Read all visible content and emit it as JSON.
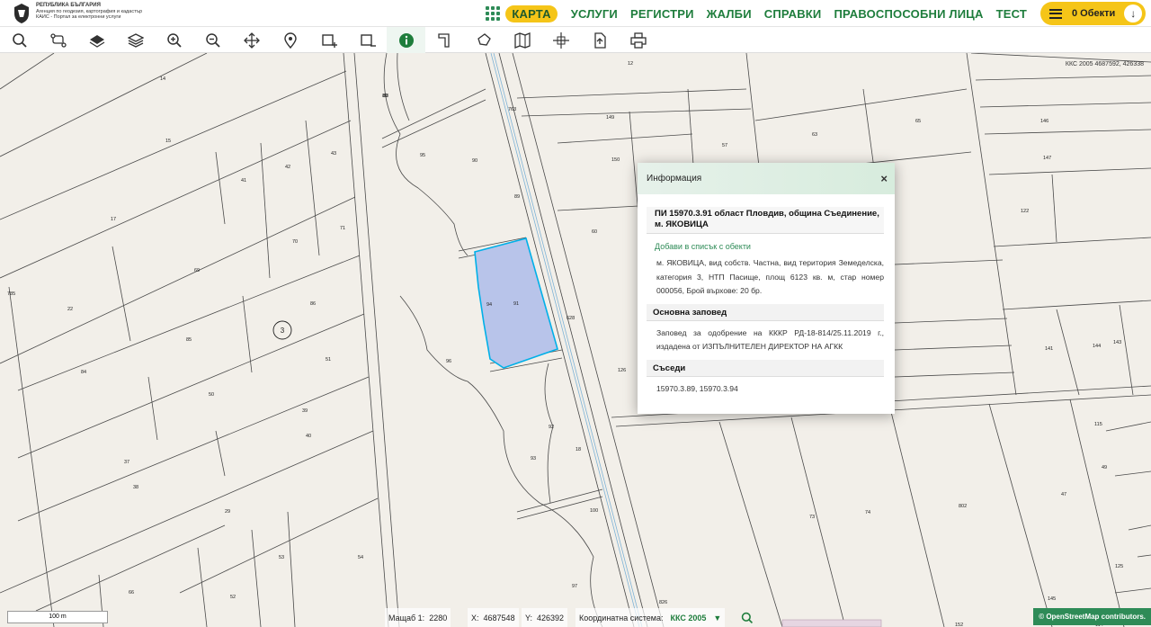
{
  "header": {
    "logo_line1": "РЕПУБЛИКА БЪЛГАРИЯ",
    "logo_line2": "Агенция по геодезия, картография и кадастър",
    "logo_line3": "КАИС - Портал за електронни услуги",
    "nav": [
      "КАРТА",
      "УСЛУГИ",
      "РЕГИСТРИ",
      "ЖАЛБИ",
      "СПРАВКИ",
      "ПРАВОСПОСОБНИ ЛИЦА",
      "ТЕСТ"
    ],
    "objects_label": "0 Обекти"
  },
  "toolbar": {
    "tools": [
      "search-icon",
      "route-icon",
      "layers-icon",
      "layers-alt-icon",
      "zoom-in-icon",
      "zoom-out-icon",
      "pan-icon",
      "location-pin-icon",
      "select-add-icon",
      "select-remove-icon",
      "info-icon",
      "measure-icon",
      "draw-polygon-icon",
      "map-icon",
      "crosshair-icon",
      "export-icon",
      "print-icon"
    ],
    "active": "info-icon"
  },
  "map": {
    "coord_label": "ККС 2005 4687592, 426338",
    "selected_parcel": "91",
    "marker_label": "3",
    "parcel_numbers": [
      "12",
      "14",
      "15",
      "17",
      "18",
      "22",
      "29",
      "37",
      "38",
      "39",
      "40",
      "41",
      "42",
      "43",
      "47",
      "49",
      "50",
      "51",
      "52",
      "53",
      "54",
      "57",
      "60",
      "63",
      "65",
      "66",
      "69",
      "70",
      "71",
      "73",
      "74",
      "80",
      "84",
      "85",
      "86",
      "88",
      "89",
      "90",
      "91",
      "92",
      "93",
      "94",
      "95",
      "96",
      "97",
      "100",
      "114",
      "115",
      "122",
      "125",
      "126",
      "141",
      "143",
      "144",
      "145",
      "146",
      "147",
      "149",
      "150",
      "152",
      "763",
      "785",
      "802",
      "826",
      "628"
    ],
    "scale_text": "100 m"
  },
  "popup": {
    "header": "Информация",
    "close": "×",
    "title": "ПИ 15970.3.91 област Пловдив, община Съединение, м. ЯКОВИЦА",
    "add_link": "Добави в списък с обекти",
    "description": "м. ЯКОВИЦА, вид собств. Частна, вид територия Земеделска, категория 3, НТП Пасище, площ 6123 кв. м, стар номер 000056, Брой върхове: 20 бр.",
    "order_heading": "Основна заповед",
    "order_text": "Заповед за одобрение на КККР РД-18-814/25.11.2019 г., издадена от ИЗПЪЛНИТЕЛЕН ДИРЕКТОР НА АГКК",
    "neighbors_heading": "Съседи",
    "neighbors_text": "15970.3.89, 15970.3.94"
  },
  "status": {
    "scale_label": "Мащаб 1:",
    "scale_value": "2280",
    "x_label": "X:",
    "x_value": "4687548",
    "y_label": "Y:",
    "y_value": "426392",
    "crs_label": "Координатна система:",
    "crs_value": "ККС 2005",
    "osm_credit": "© OpenStreetMap contributors."
  },
  "colors": {
    "brand_green": "#1e7d3c",
    "accent_yellow": "#f5c518",
    "parcel_fill": "#b8c4ea",
    "parcel_outline": "#00b0e8"
  }
}
